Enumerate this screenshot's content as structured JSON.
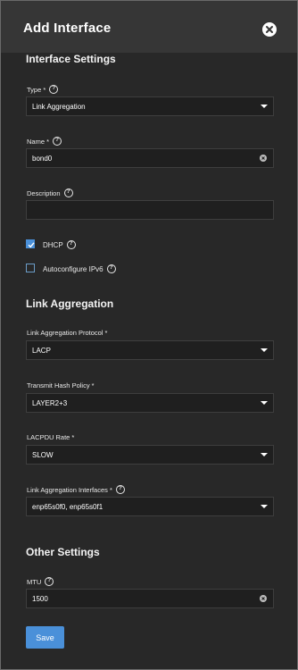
{
  "header": {
    "title": "Add Interface"
  },
  "sections": {
    "interface_settings": "Interface Settings",
    "link_aggregation": "Link Aggregation",
    "other_settings": "Other Settings"
  },
  "fields": {
    "type": {
      "label": "Type *",
      "value": "Link Aggregation"
    },
    "name": {
      "label": "Name *",
      "value": "bond0"
    },
    "description": {
      "label": "Description",
      "value": ""
    },
    "dhcp": {
      "label": "DHCP",
      "checked": true
    },
    "ipv6": {
      "label": "Autoconfigure IPv6",
      "checked": false
    },
    "protocol": {
      "label": "Link Aggregation Protocol *",
      "value": "LACP"
    },
    "hash_policy": {
      "label": "Transmit Hash Policy *",
      "value": "LAYER2+3"
    },
    "lacpdu_rate": {
      "label": "LACPDU Rate *",
      "value": "SLOW"
    },
    "interfaces": {
      "label": "Link Aggregation Interfaces *",
      "value": "enp65s0f0, enp65s0f1"
    },
    "mtu": {
      "label": "MTU",
      "value": "1500"
    }
  },
  "actions": {
    "save": "Save"
  },
  "colors": {
    "accent": "#4a90d9",
    "background": "#282828",
    "header": "#363636",
    "input": "#1f1f1f"
  }
}
